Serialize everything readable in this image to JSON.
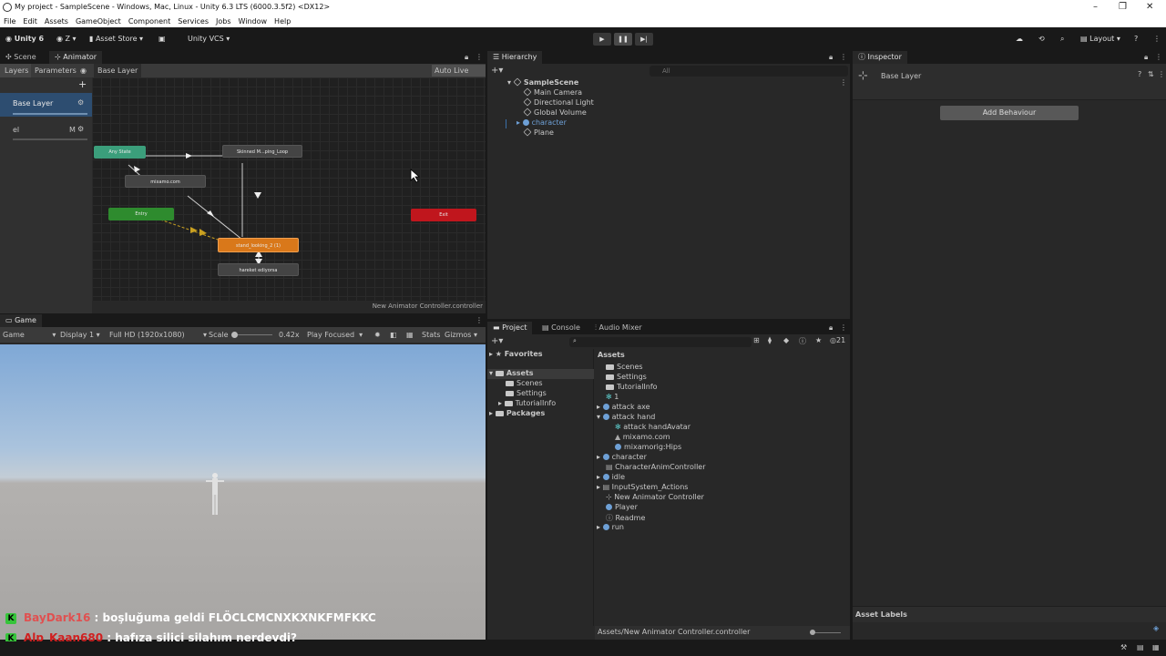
{
  "window": {
    "title": "My project - SampleScene - Windows, Mac, Linux - Unity 6.3 LTS (6000.3.5f2) <DX12>"
  },
  "menu": [
    "File",
    "Edit",
    "Assets",
    "GameObject",
    "Component",
    "Services",
    "Jobs",
    "Window",
    "Help"
  ],
  "toolbar": {
    "unity": "Unity 6",
    "account": "Z",
    "asset_store": "Asset Store",
    "vcs": "Unity VCS",
    "layout": "Layout"
  },
  "animator": {
    "tabs": [
      "Scene",
      "Animator"
    ],
    "subtabs": [
      "Layers",
      "Parameters"
    ],
    "breadcrumb": "Base Layer",
    "auto_live_link": "Auto Live Link",
    "layers": [
      {
        "name": "Base Layer"
      },
      {
        "name": "el",
        "flag": "M"
      }
    ],
    "footer": "New Animator Controller.controller",
    "nodes": {
      "any_state": "Any State",
      "skinned": "Skinned M...ping_Loop",
      "mixamo": "mixamo.com",
      "entry": "Entry",
      "exit": "Exit",
      "stand": "stand_looking_2 (1)",
      "hareket": "hareket ediyorsa"
    }
  },
  "hierarchy": {
    "tab": "Hierarchy",
    "search_placeholder": "All",
    "scene": "SampleScene",
    "items": [
      "Main Camera",
      "Directional Light",
      "Global Volume",
      "character",
      "Plane"
    ]
  },
  "inspector": {
    "tab": "Inspector",
    "title": "Base Layer",
    "add_behaviour": "Add Behaviour",
    "asset_labels": "Asset Labels"
  },
  "game": {
    "tab": "Game",
    "mode": "Game",
    "display": "Display 1",
    "resolution": "Full HD (1920x1080)",
    "scale_label": "Scale",
    "scale_value": "0.42x",
    "play_focused": "Play Focused",
    "stats": "Stats",
    "gizmos": "Gizmos"
  },
  "project": {
    "tabs": [
      "Project",
      "Console",
      "Audio Mixer"
    ],
    "count": "21",
    "tree": {
      "favorites": "Favorites",
      "assets": "Assets",
      "children": [
        "Scenes",
        "Settings",
        "TutorialInfo"
      ],
      "packages": "Packages"
    },
    "header": "Assets",
    "assets": [
      "Scenes",
      "Settings",
      "TutorialInfo",
      "1",
      "attack axe",
      "attack hand",
      "attack handAvatar",
      "mixamo.com",
      "mixamorig:Hips",
      "character",
      "CharacterAnimController",
      "idle",
      "InputSystem_Actions",
      "New Animator Controller",
      "Player",
      "Readme",
      "run"
    ],
    "footer": "Assets/New Animator Controller.controller"
  },
  "chat": [
    {
      "user": "BayDark16",
      "msg": ": boşluğuma geldi FLÖCLCMCNXKXNKFMFKKC",
      "color": "#e05050"
    },
    {
      "user": "Alp_Kaan680",
      "msg": ": hafıza silici silahım nerdeydi?",
      "color": "#d02020"
    }
  ],
  "colors": {
    "entry": "#2e8b2e",
    "any_state": "#3b9e7b",
    "exit": "#c0161d",
    "default_state": "#d9781a",
    "accent": "#3a6fa8"
  }
}
